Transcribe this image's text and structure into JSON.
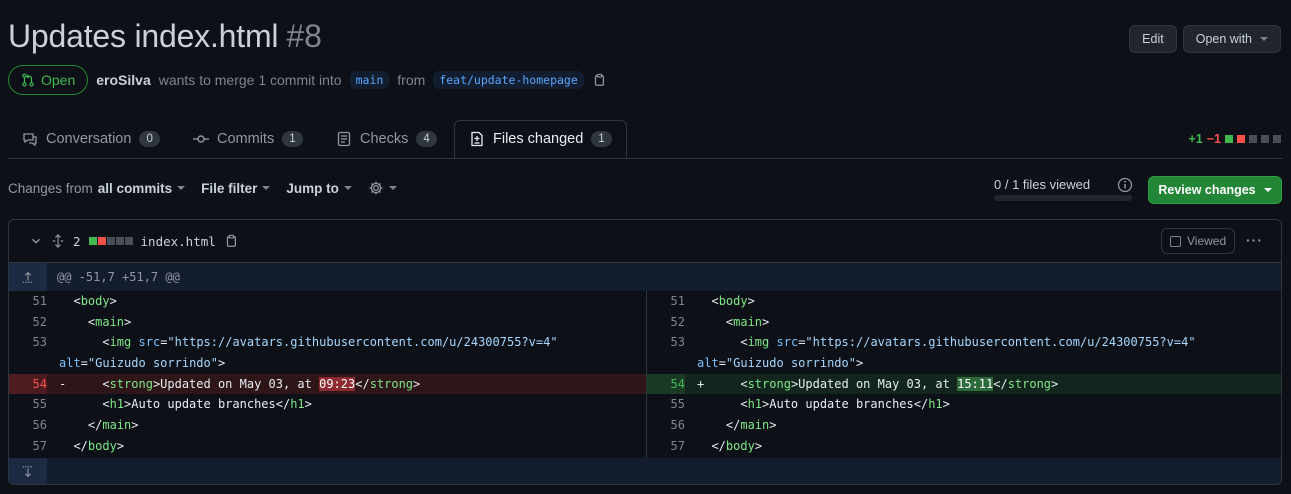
{
  "pr": {
    "title": "Updates index.html",
    "number": "#8",
    "state": "Open",
    "author": "eroSilva",
    "merge_text": "wants to merge 1 commit into",
    "base_branch": "main",
    "from_text": "from",
    "head_branch": "feat/update-homepage"
  },
  "header_buttons": {
    "edit": "Edit",
    "open_with": "Open with"
  },
  "tabs": [
    {
      "label": "Conversation",
      "count": "0"
    },
    {
      "label": "Commits",
      "count": "1"
    },
    {
      "label": "Checks",
      "count": "4"
    },
    {
      "label": "Files changed",
      "count": "1"
    }
  ],
  "diffstat": {
    "additions": "+1",
    "deletions": "−1"
  },
  "toolbar": {
    "changes_from_prefix": "Changes from",
    "changes_from_value": "all commits",
    "file_filter": "File filter",
    "jump_to": "Jump to",
    "files_viewed": "0 / 1 files viewed",
    "files_viewed_fraction": 0,
    "review_changes": "Review changes"
  },
  "file": {
    "changes": "2",
    "name": "index.html",
    "viewed_label": "Viewed",
    "hunk": "@@ -51,7 +51,7 @@"
  },
  "colors": {
    "accent_green": "#238636",
    "add": "#3fb950",
    "del": "#f85149",
    "link": "#58a6ff"
  }
}
